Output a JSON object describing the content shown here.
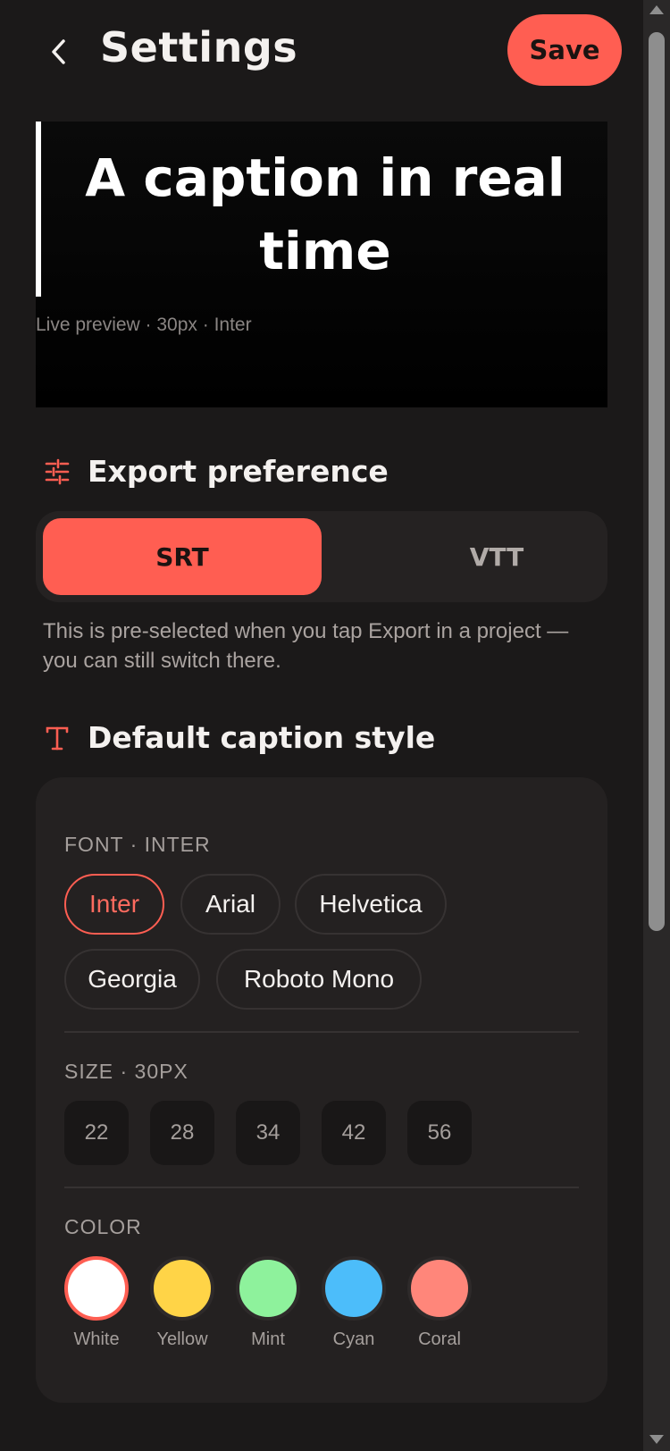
{
  "header": {
    "title": "Settings",
    "back_icon": "chevron-left-icon",
    "save_label": "Save"
  },
  "preview": {
    "caption_text": "A caption in real time",
    "meta": "Live preview · 30px · Inter"
  },
  "export": {
    "heading": "Export preference",
    "icon": "sliders-icon",
    "options": [
      "SRT",
      "VTT"
    ],
    "selected": "SRT",
    "hint": "This is pre-selected when you tap Export in a project — you can still switch there."
  },
  "caption_style": {
    "heading": "Default caption style",
    "icon": "text-type-icon",
    "font_label": "FONT · INTER",
    "fonts": [
      "Inter",
      "Arial",
      "Helvetica",
      "Georgia",
      "Roboto Mono"
    ],
    "selected_font": "Inter",
    "size_label": "SIZE · 30PX",
    "sizes": [
      "22",
      "28",
      "34",
      "42",
      "56"
    ],
    "color_label": "COLOR",
    "colors": [
      {
        "name": "White",
        "hex": "#ffffff"
      },
      {
        "name": "Yellow",
        "hex": "#ffd447"
      },
      {
        "name": "Mint",
        "hex": "#8ef29c"
      },
      {
        "name": "Cyan",
        "hex": "#4cbdfa"
      },
      {
        "name": "Coral",
        "hex": "#ff867a"
      }
    ],
    "selected_color": "White"
  },
  "theme": {
    "accent": "#ff5e52",
    "background": "#1b1919",
    "card": "#242121"
  }
}
